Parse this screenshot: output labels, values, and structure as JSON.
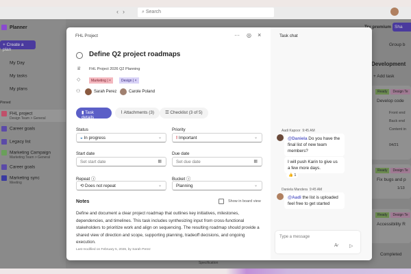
{
  "browser": {
    "search_placeholder": "Search",
    "back": "‹",
    "forward": "›"
  },
  "sidebar": {
    "app_name": "Planner",
    "create_label": "+ Create a plan",
    "nav": [
      {
        "label": "My Day",
        "icon": "sun-icon"
      },
      {
        "label": "My tasks",
        "icon": "task-icon"
      },
      {
        "label": "My plans",
        "icon": "grid-icon"
      }
    ],
    "pinned_label": "Pinned",
    "plans": [
      {
        "label": "FHL project",
        "sub": "Design Team > General",
        "color": "#c0506a"
      },
      {
        "label": "Career goals",
        "color": "#5b4aa8"
      },
      {
        "label": "Legacy list",
        "color": "#5b4aa8"
      },
      {
        "label": "Marketing Campaign",
        "sub": "Marketing Team > General",
        "color": "#6aa05a"
      },
      {
        "label": "Career goals",
        "color": "#5b4aa8"
      },
      {
        "label": "Marketing sync",
        "sub": "Meeting",
        "color": "#3a3aa0"
      }
    ]
  },
  "board": {
    "premium": "Try premium",
    "share": "Sha",
    "group_by": "Group b",
    "column": "Development",
    "add_task": "+ Add task",
    "cards": [
      {
        "ready": "Ready",
        "tag": "Design Te",
        "title": "Develop code",
        "checklist": [
          "Front end",
          "Back end",
          "Content in"
        ],
        "date": "04/21"
      },
      {
        "ready": "Ready",
        "tag": "Design Te",
        "title": "Fix bugs and p",
        "date": "1/13"
      },
      {
        "ready": "Ready",
        "tag": "Design Te",
        "title": "Accessibility R"
      }
    ],
    "completed": "Completed"
  },
  "behind_text": "Specification",
  "task": {
    "breadcrumb": "FHL Project",
    "title": "Define Q2 project roadmaps",
    "plan": "FHL Project 2026 Q2 Planning",
    "labels": [
      {
        "name": "Marketing",
        "color": "#f4b8bf"
      },
      {
        "name": "Design",
        "color": "#d9d3f7"
      }
    ],
    "assignees": [
      "Sarah Perez",
      "Carole Poland"
    ],
    "tabs": [
      "Task details",
      "Attachments (3)",
      "Checklist (3 of 5)"
    ],
    "status": {
      "label": "Status",
      "value": "In progress"
    },
    "priority": {
      "label": "Priority",
      "value": "Important"
    },
    "start": {
      "label": "Start date",
      "placeholder": "Set start date"
    },
    "due": {
      "label": "Due date",
      "placeholder": "Set due date"
    },
    "repeat": {
      "label": "Repeat",
      "value": "Does not repeat"
    },
    "bucket": {
      "label": "Bucket",
      "value": "Planning"
    },
    "notes_label": "Notes",
    "show_board": "Show in board view",
    "notes": "Define and document a clear project roadmap that outlines key initiatives, milestones, dependencies, and timelines. This task includes synthesizing input from cross-functional stakeholders to prioritize work and align on sequencing. The resulting roadmap should provide a shared view of direction and scope, supporting planning, tradeoff decisions, and ongoing execution.",
    "modified": "Last modified on February 5, 2026, by Sarah Perez"
  },
  "chat": {
    "title": "Task chat",
    "messages": [
      {
        "author": "Aadi Kapoor",
        "time": "9:45 AM",
        "mention": "@Daniela",
        "text": " Do you have the final list of new team members?",
        "followup": "I will push Karin to give us a few more days.",
        "reaction": "👍",
        "reaction_count": "1"
      },
      {
        "author": "Daniela Mandera",
        "time": "9:45 AM",
        "mention": "@Aadi",
        "text": " the list is uploaded feel free to get started"
      }
    ],
    "placeholder": "Type a message"
  },
  "colors": {
    "accent": "#5b5fc7",
    "priority": "#c50f1f"
  }
}
